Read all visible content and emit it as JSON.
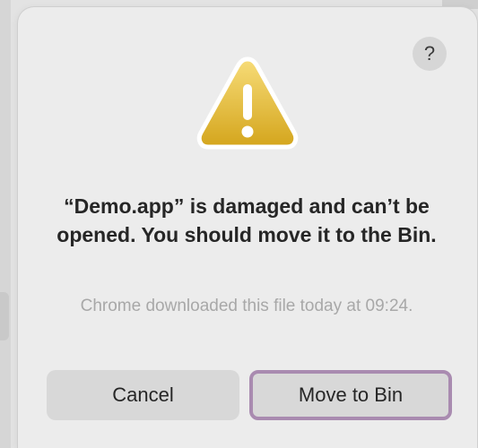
{
  "dialog": {
    "help_label": "?",
    "icon": "warning-triangle-icon",
    "title": "“Demo.app” is damaged and can’t be opened. You should move it to the Bin.",
    "message": "Chrome downloaded this file today at 09:24.",
    "buttons": {
      "cancel": "Cancel",
      "move_to_bin": "Move to Bin"
    }
  },
  "colors": {
    "warning_top": "#f5d468",
    "warning_bottom": "#d7a81f",
    "focus_ring": "#a98bb0"
  }
}
